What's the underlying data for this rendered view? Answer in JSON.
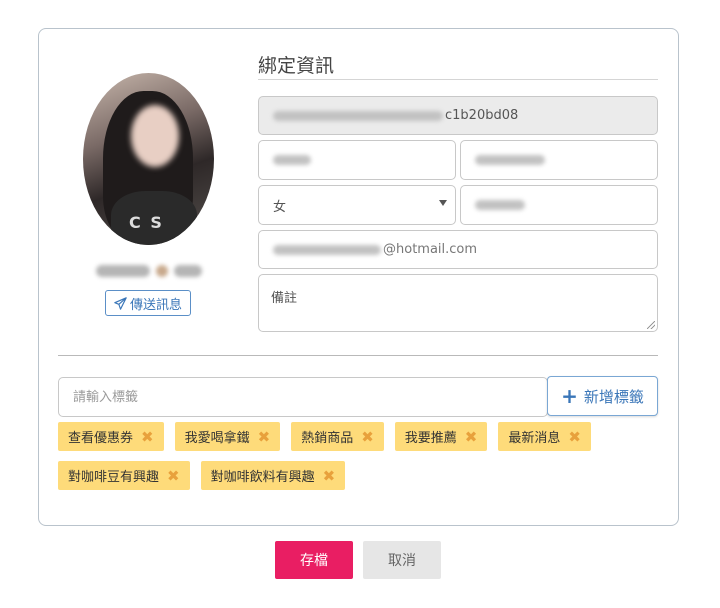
{
  "profile": {
    "send_message_label": "傳送訊息"
  },
  "binding": {
    "title": "綁定資訊",
    "id_suffix": "c1b20bd08",
    "gender": "女",
    "email_suffix": "@hotmail.com",
    "note": "備註"
  },
  "tags": {
    "input_placeholder": "請輸入標籤",
    "add_label": "新增標籤",
    "items": [
      {
        "label": "查看優惠券"
      },
      {
        "label": "我愛喝拿鐵"
      },
      {
        "label": "熱銷商品"
      },
      {
        "label": "我要推薦"
      },
      {
        "label": "最新消息"
      },
      {
        "label": "對咖啡豆有興趣"
      },
      {
        "label": "對咖啡飲料有興趣"
      }
    ],
    "remove_glyph": "✖"
  },
  "actions": {
    "save_label": "存檔",
    "cancel_label": "取消"
  },
  "colors": {
    "accent_pink": "#e91e63",
    "tag_yellow": "#fedb7a",
    "link_blue": "#3a76b8"
  }
}
